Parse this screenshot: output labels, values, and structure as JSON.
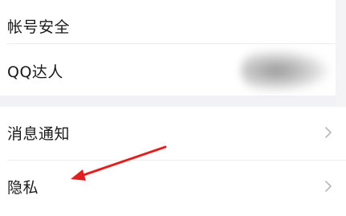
{
  "settings": {
    "account_security": {
      "label": "帐号安全"
    },
    "qq_talent": {
      "label": "QQ达人"
    },
    "message_notification": {
      "label": "消息通知"
    },
    "privacy": {
      "label": "隐私"
    }
  },
  "icons": {
    "chevron": "chevron-right-icon"
  },
  "colors": {
    "arrow_annotation": "#e02020",
    "chevron": "#b8b8b8",
    "background": "#f2f2f6",
    "card": "#ffffff"
  }
}
